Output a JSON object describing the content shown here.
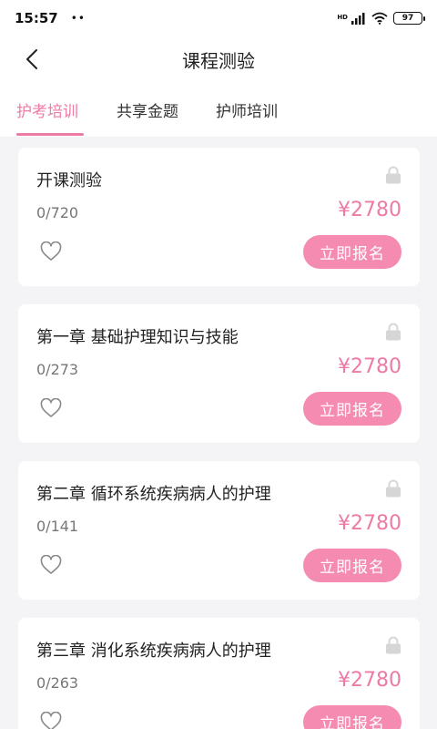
{
  "status_bar": {
    "time": "15:57",
    "dots": "••",
    "network_badge": "HD",
    "battery": "97"
  },
  "header": {
    "title": "课程测验"
  },
  "tabs": [
    {
      "label": "护考培训",
      "active": true
    },
    {
      "label": "共享金题",
      "active": false
    },
    {
      "label": "护师培训",
      "active": false
    }
  ],
  "courses": [
    {
      "title": "开课测验",
      "progress": "0/720",
      "price": "¥2780",
      "button": "立即报名"
    },
    {
      "title": "第一章 基础护理知识与技能",
      "progress": "0/273",
      "price": "¥2780",
      "button": "立即报名"
    },
    {
      "title": "第二章 循环系统疾病病人的护理",
      "progress": "0/141",
      "price": "¥2780",
      "button": "立即报名"
    },
    {
      "title": "第三章 消化系统疾病病人的护理",
      "progress": "0/263",
      "price": "¥2780",
      "button": "立即报名"
    }
  ],
  "colors": {
    "accent": "#ee7aa6",
    "button_bg": "#f58bb0",
    "page_bg": "#f4f4f6"
  }
}
